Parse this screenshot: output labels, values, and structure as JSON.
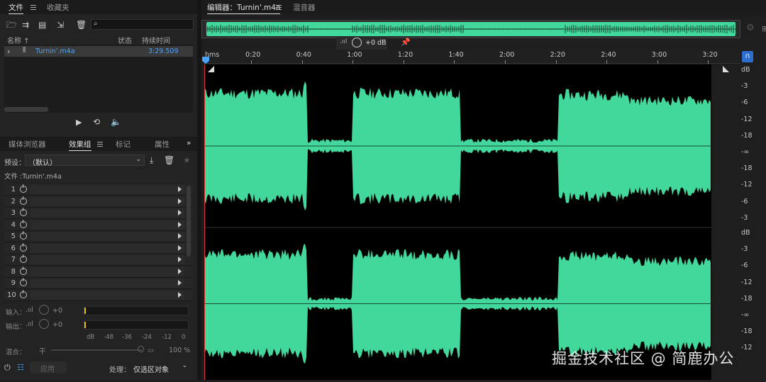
{
  "left_panel": {
    "tabs": [
      {
        "label": "文件",
        "active": true
      },
      {
        "label": "收藏夹",
        "active": false
      }
    ],
    "columns": {
      "name": "名称",
      "status": "状态",
      "duration": "持续时间"
    },
    "file": {
      "name": "Turnin'.m4a",
      "duration": "3:29.509"
    },
    "effects_tabs": [
      {
        "label": "媒体浏览器",
        "active": false
      },
      {
        "label": "效果组",
        "active": true
      },
      {
        "label": "标记",
        "active": false
      },
      {
        "label": "属性",
        "active": false
      }
    ],
    "preset_label": "预设：",
    "preset_value": "（默认）",
    "file_line": "文件 :Turnin'.m4a",
    "effect_slots": [
      "1",
      "2",
      "3",
      "4",
      "5",
      "6",
      "7",
      "8",
      "9",
      "10"
    ],
    "input_label": "输入：",
    "output_label": "输出：",
    "input_gain": "+0",
    "output_gain": "+0",
    "meter_ticks": [
      "dB",
      "-48",
      "-36",
      "-24",
      "-12",
      "0"
    ],
    "mix_label": "混合：",
    "mix_dry": "干",
    "mix_percent": "100 %",
    "apply_label": "应用",
    "process_label": "处理：",
    "process_value": "仅选区对象"
  },
  "editor": {
    "tab_label": "编辑器：Turnin'.m4a",
    "mixer_label": "混音器",
    "gain_readout": "+0 dB",
    "ruler_unit": "hms",
    "ruler_ticks": [
      "0:20",
      "0:40",
      "1:00",
      "1:20",
      "1:40",
      "2:00",
      "2:20",
      "2:40",
      "3:00",
      "3:20"
    ],
    "db_ticks_top": [
      "dB",
      "-3",
      "-6",
      "-12",
      "-18",
      "-∞",
      "-18",
      "-12",
      "-6",
      "-3"
    ],
    "db_ticks_bottom": [
      "dB",
      "-3",
      "-6",
      "-12",
      "-18",
      "-∞",
      "-18",
      "-12"
    ],
    "waveform_color": "#42d79b",
    "watermark": "掘金技术社区 @ 简鹿办公"
  }
}
